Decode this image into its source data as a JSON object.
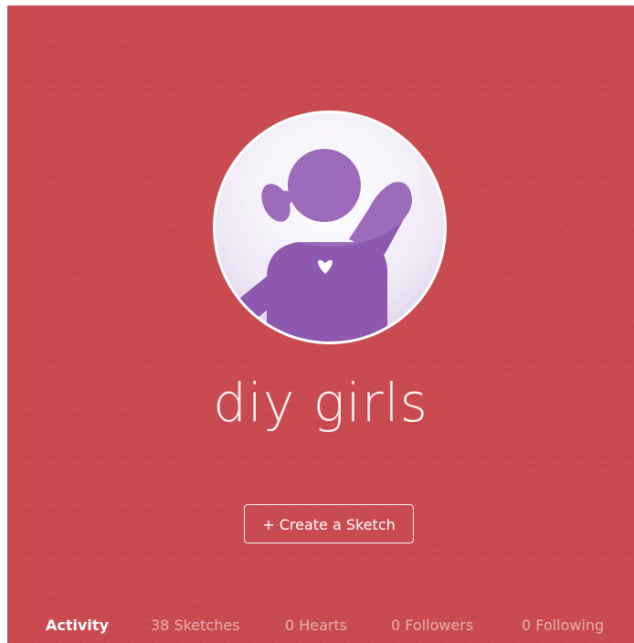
{
  "profile": {
    "name": "diy girls",
    "avatar_icon": "girl-waving-heart-icon",
    "colors": {
      "background": "#c94a4f",
      "avatar_purple": "#8e57b0",
      "avatar_bg": "#f3effa"
    }
  },
  "actions": {
    "create_label": "+ Create a Sketch"
  },
  "tabs": [
    {
      "label": "Activity",
      "active": true
    },
    {
      "label": "38 Sketches",
      "active": false
    },
    {
      "label": "0 Hearts",
      "active": false
    },
    {
      "label": "0 Followers",
      "active": false
    },
    {
      "label": "0 Following",
      "active": false
    }
  ]
}
